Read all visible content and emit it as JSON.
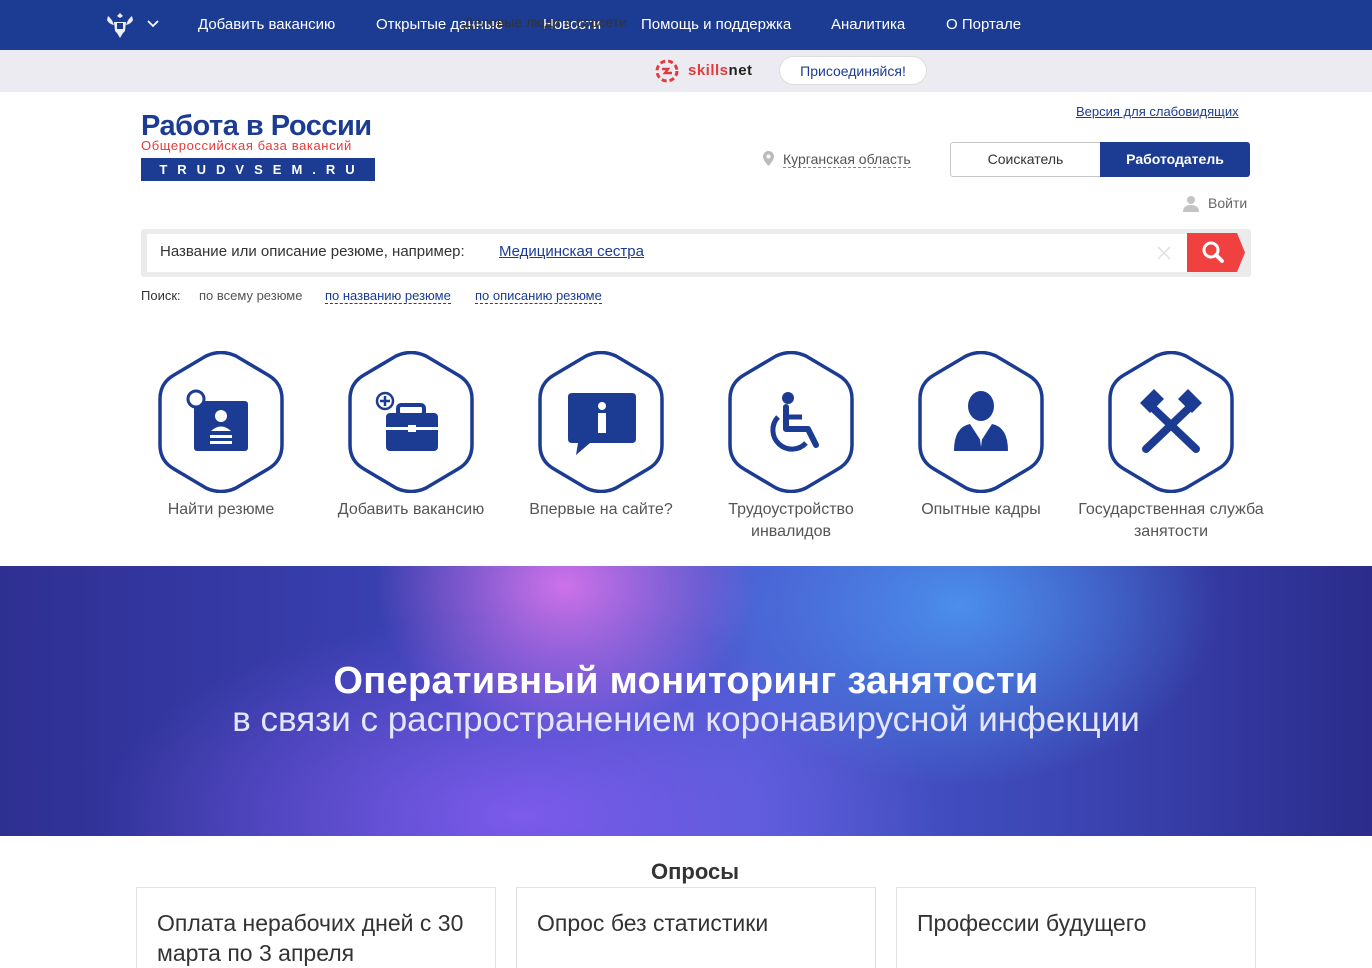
{
  "topnav": {
    "emblem_icon": "coat-of-arms-icon",
    "links": [
      {
        "label": "Добавить вакансию"
      },
      {
        "label": "Открытые данные"
      },
      {
        "label": "Новости"
      },
      {
        "label": "Помощь и поддержка"
      },
      {
        "label": "Аналитика"
      },
      {
        "label": "О Портале"
      }
    ]
  },
  "promo": {
    "text": "Деловые люди в соцсети",
    "brand_a": "skills",
    "brand_b": "net",
    "join_label": "Присоединяйся!"
  },
  "header": {
    "logo_title": "Работа в России",
    "logo_subtitle": "Общероссийская база вакансий",
    "logo_domain": "TRUDVSEM.RU",
    "accessibility_link": "Версия для слабовидящих",
    "region": "Курганская область",
    "role_seeker": "Соискатель",
    "role_employer": "Работодатель",
    "login": "Войти"
  },
  "search": {
    "hint": "Название или описание резюме, например:",
    "example": "Медицинская сестра",
    "filter_label": "Поиск:",
    "filters": [
      "по всему резюме",
      "по названию резюме",
      "по описанию резюме"
    ]
  },
  "tiles": [
    {
      "label": "Найти резюме",
      "icon": "find-resume-icon"
    },
    {
      "label": "Добавить вакансию",
      "icon": "add-vacancy-briefcase-icon"
    },
    {
      "label": "Впервые на сайте?",
      "icon": "info-icon"
    },
    {
      "label": "Трудоустройство инвалидов",
      "icon": "wheelchair-icon"
    },
    {
      "label": "Опытные кадры",
      "icon": "businessman-icon"
    },
    {
      "label": "Государственная служба занятости",
      "icon": "crossed-hammers-icon"
    }
  ],
  "banner": {
    "title": "Оперативный мониторинг занятости",
    "subtitle": "в связи с распространением коронавирусной инфекции"
  },
  "surveys": {
    "title": "Опросы",
    "cards": [
      {
        "title": "Оплата нерабочих дней с 30 марта по 3 апреля"
      },
      {
        "title": "Опрос без статистики"
      },
      {
        "title": "Профессии будущего"
      }
    ]
  },
  "colors": {
    "brand_blue": "#1c3c94",
    "accent_red": "#f04040",
    "promo_bg": "#ecebf1"
  }
}
